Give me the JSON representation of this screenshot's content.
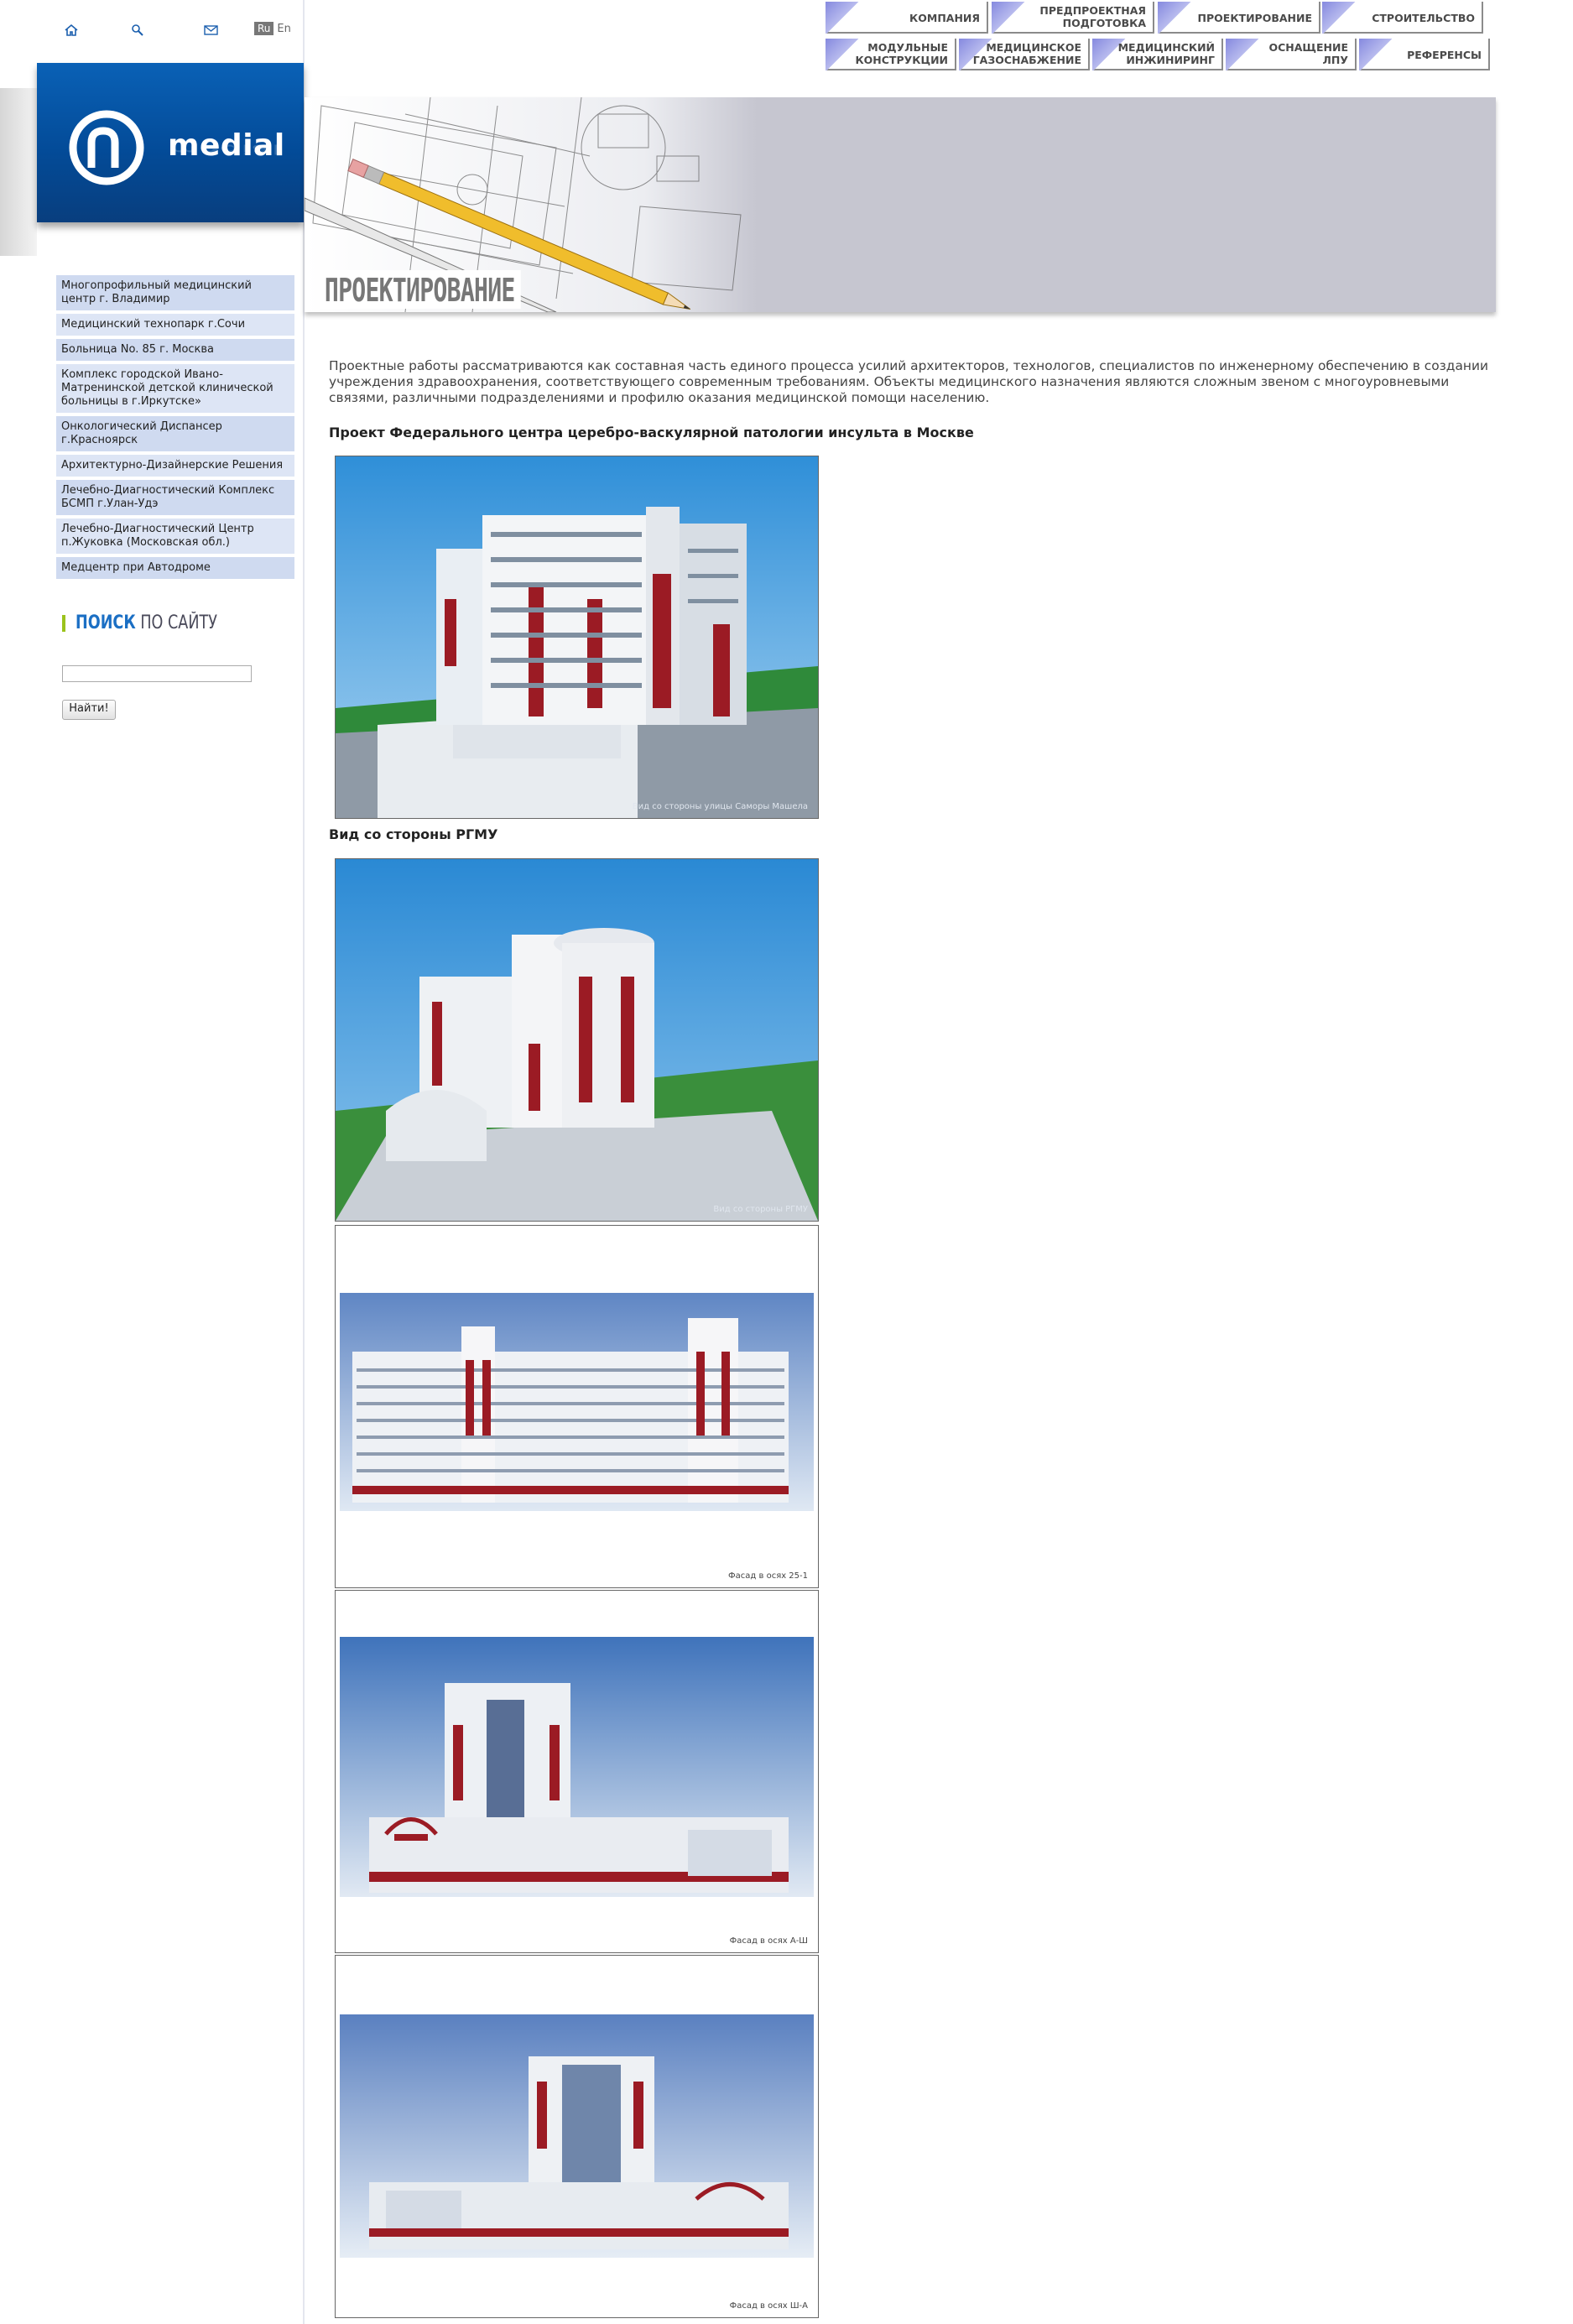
{
  "lang": {
    "ru": "Ru",
    "en": "En"
  },
  "logo": {
    "text": "medial"
  },
  "nav_top": [
    {
      "label": "КОМПАНИЯ"
    },
    {
      "label1": "ПРЕДПРОЕКТНАЯ",
      "label2": "ПОДГОТОВКА"
    },
    {
      "label": "ПРОЕКТИРОВАНИЕ"
    },
    {
      "label": "СТРОИТЕЛЬСТВО"
    }
  ],
  "nav_bottom": [
    {
      "label1": "МОДУЛЬНЫЕ",
      "label2": "КОНСТРУКЦИИ"
    },
    {
      "label1": "МЕДИЦИНСКОЕ",
      "label2": "ГАЗОСНАБЖЕНИЕ"
    },
    {
      "label1": "МЕДИЦИНСКИЙ",
      "label2": "ИНЖИНИРИНГ"
    },
    {
      "label1": "ОСНАЩЕНИЕ",
      "label2": "ЛПУ"
    },
    {
      "label": "РЕФЕРЕНСЫ"
    }
  ],
  "banner": {
    "title": "ПРОЕКТИРОВАНИЕ"
  },
  "side_menu": [
    "Многопрофильный медицинский центр г. Владимир",
    "Медицинский технопарк г.Сочи",
    "Больница No. 85 г. Москва",
    "Комплекс городской Ивано-Матренинской детской клинической больницы в г.Иркутске»",
    "Онкологический Диспансер г.Красноярск",
    "Архитектурно-Дизайнерские Решения",
    "Лечебно-Диагностический Комплекс БСМП г.Улан-Удэ",
    "Лечебно-Диагностический Центр п.Жуковка (Московская обл.)",
    "Медцентр при Автодроме"
  ],
  "search": {
    "title_bold": "ПОИСК",
    "title_rest": " ПО САЙТУ",
    "button": "Найти!"
  },
  "content": {
    "intro": "Проектные работы рассматриваются как составная часть единого процесса усилий архитекторов, технологов, специалистов по инженерному обеспечению в создании учреждения здравоохранения, соответствующего современным требованиям. Объекты медицинского назначения являются сложным звеном с многоуровневыми связями, различными подразделениями и профилю оказания медицинской помощи населению.",
    "project_title": "Проект Федерального центра церебро-васкулярной патологии инсульта в Москве",
    "caption_rgmu": "Вид со стороны РГМУ",
    "images": [
      {
        "caption": "Вид со стороны улицы Саморы Машела"
      },
      {
        "caption": "Вид со стороны РГМУ"
      },
      {
        "caption": "Фасад в осях 25-1"
      },
      {
        "caption": "Фасад в осях А-Ш"
      },
      {
        "caption": "Фасад в осях Ш-А"
      }
    ]
  },
  "colors": {
    "logo_blue": "#034b98",
    "nav_triangle": "#9fa3e4",
    "side_bg": "#cfdaf0",
    "search_bar": "#9bc31c"
  }
}
